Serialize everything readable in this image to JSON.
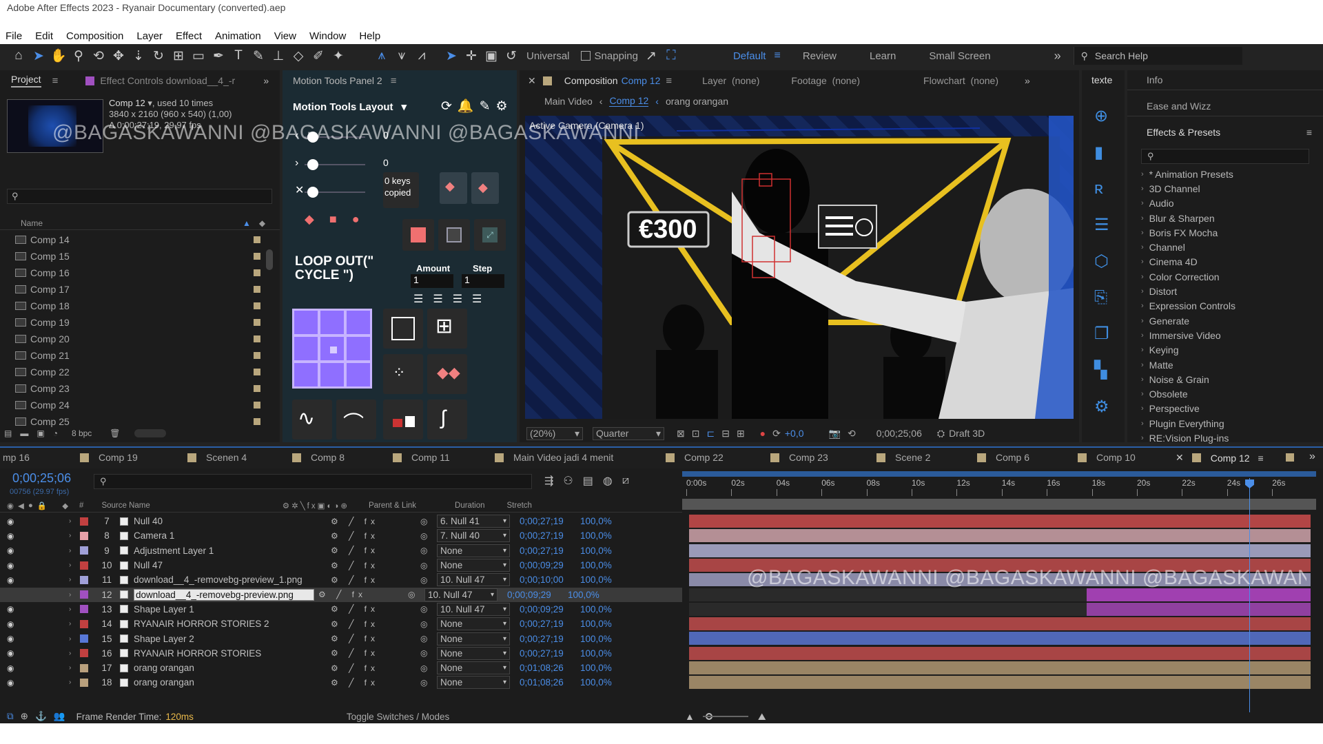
{
  "title": "Adobe After Effects 2023 - Ryanair Documentary (converted).aep",
  "menu": [
    "File",
    "Edit",
    "Composition",
    "Layer",
    "Effect",
    "Animation",
    "View",
    "Window",
    "Help"
  ],
  "toolbar": {
    "universal": "Universal",
    "snapping": "Snapping",
    "workspaces": [
      "Default",
      "Review",
      "Learn",
      "Small Screen"
    ],
    "search_help": "Search Help"
  },
  "project": {
    "tab": "Project",
    "effect_controls": "Effect Controls download__4_-r",
    "comp_name": "Comp 12",
    "used": ", used 10 times",
    "res": "3840 x 2160  (960 x 540) (1,00)",
    "dur": "Δ 0;00;27;19, 29,97 fps",
    "col_name": "Name",
    "items": [
      "Comp 14",
      "Comp 15",
      "Comp 16",
      "Comp 17",
      "Comp 18",
      "Comp 19",
      "Comp 20",
      "Comp 21",
      "Comp 22",
      "Comp 23",
      "Comp 24",
      "Comp 25"
    ],
    "bpc": "8 bpc",
    "label_color": "#b9a77d"
  },
  "motion": {
    "tab": "Motion Tools Panel 2",
    "layout": "Motion Tools Layout",
    "val0": "0",
    "val1": "0",
    "val2": "0",
    "keys": "0 keys",
    "copied": "copied",
    "loop": "LOOP OUT(\" CYCLE \")",
    "amount": "Amount",
    "step": "Step",
    "amount_val": "1",
    "step_val": "1"
  },
  "comp": {
    "tab_prefix": "Composition",
    "tab_name": "Comp 12",
    "layer": "Layer  (none)",
    "footage": "Footage  (none)",
    "flowchart": "Flowchart  (none)",
    "crumbs": [
      "Main Video",
      "Comp 12",
      "orang orangan"
    ],
    "camera": "Active Camera (Camera 1)",
    "price": "€300",
    "zoom": "(20%)",
    "quality": "Quarter",
    "exposure": "+0,0",
    "timecode": "0;00;25;06",
    "renderer": "Draft 3D"
  },
  "texte": "texte",
  "right": {
    "info": "Info",
    "ease": "Ease and Wizz",
    "effects_title": "Effects & Presets",
    "items": [
      "* Animation Presets",
      "3D Channel",
      "Audio",
      "Blur & Sharpen",
      "Boris FX Mocha",
      "Channel",
      "Cinema 4D",
      "Color Correction",
      "Distort",
      "Expression Controls",
      "Generate",
      "Immersive Video",
      "Keying",
      "Matte",
      "Noise & Grain",
      "Obsolete",
      "Perspective",
      "Plugin Everything",
      "RE:Vision Plug-ins"
    ]
  },
  "tabs": [
    "mp 16",
    "Comp 19",
    "Scenen 4",
    "Comp 8",
    "Comp 11",
    "Main Video jadi 4 menit",
    "Comp 22",
    "Comp 23",
    "Scene 2",
    "Comp 6",
    "Comp 10",
    "Comp 12"
  ],
  "timeline": {
    "timecode": "0;00;25;06",
    "frames": "00756 (29.97 fps)",
    "col_source": "Source Name",
    "col_parent": "Parent & Link",
    "col_duration": "Duration",
    "col_stretch": "Stretch",
    "ruler": [
      "0:00s",
      "02s",
      "04s",
      "06s",
      "08s",
      "10s",
      "12s",
      "14s",
      "16s",
      "18s",
      "20s",
      "22s",
      "24s",
      "26s"
    ],
    "layers": [
      {
        "num": "7",
        "name": "Null 40",
        "parent": "6. Null 41",
        "dur": "0;00;27;19",
        "str": "100,0%",
        "color": "#c24040",
        "bar": "#b24545",
        "start": 0,
        "end": 1
      },
      {
        "num": "8",
        "name": "Camera 1",
        "parent": "7. Null 40",
        "dur": "0;00;27;19",
        "str": "100,0%",
        "color": "#e8a0a8",
        "bar": "#b48f95",
        "start": 0,
        "end": 1
      },
      {
        "num": "9",
        "name": "Adjustment Layer 1",
        "parent": "None",
        "dur": "0;00;27;19",
        "str": "100,0%",
        "color": "#a0a0d8",
        "bar": "#9a9ab8",
        "start": 0,
        "end": 1
      },
      {
        "num": "10",
        "name": "Null 47",
        "parent": "None",
        "dur": "0;00;09;29",
        "str": "100,0%",
        "color": "#c24040",
        "bar": "#a84545",
        "start": 0,
        "end": 1
      },
      {
        "num": "11",
        "name": "download__4_-removebg-preview_1.png",
        "parent": "10. Null 47",
        "dur": "0;00;10;00",
        "str": "100,0%",
        "color": "#a0a0d8",
        "bar": "#8a8aa8",
        "start": 0,
        "end": 1
      },
      {
        "num": "12",
        "name": "download__4_-removebg-preview.png",
        "parent": "10. Null 47",
        "dur": "0;00;09;29",
        "str": "100,0%",
        "color": "#a050c0",
        "bar": "#a040b0",
        "start": 0.64,
        "end": 1
      },
      {
        "num": "13",
        "name": "Shape Layer 1",
        "parent": "10. Null 47",
        "dur": "0;00;09;29",
        "str": "100,0%",
        "color": "#a050c0",
        "bar": "#9040a0",
        "start": 0.64,
        "end": 1
      },
      {
        "num": "14",
        "name": "RYANAIR HORROR STORIES 2",
        "parent": "None",
        "dur": "0;00;27;19",
        "str": "100,0%",
        "color": "#c24040",
        "bar": "#a84545",
        "start": 0,
        "end": 1
      },
      {
        "num": "15",
        "name": "Shape Layer 2",
        "parent": "None",
        "dur": "0;00;27;19",
        "str": "100,0%",
        "color": "#5878d8",
        "bar": "#5068b8",
        "start": 0,
        "end": 1
      },
      {
        "num": "16",
        "name": "RYANAIR HORROR STORIES",
        "parent": "None",
        "dur": "0;00;27;19",
        "str": "100,0%",
        "color": "#c24040",
        "bar": "#a84545",
        "start": 0,
        "end": 1
      },
      {
        "num": "17",
        "name": "orang orangan",
        "parent": "None",
        "dur": "0;01;08;26",
        "str": "100,0%",
        "color": "#b9a07d",
        "bar": "#9a8565",
        "start": 0,
        "end": 1
      },
      {
        "num": "18",
        "name": "orang orangan",
        "parent": "None",
        "dur": "0;01;08;26",
        "str": "100,0%",
        "color": "#b9a07d",
        "bar": "#9a8565",
        "start": 0,
        "end": 1
      }
    ],
    "render_label": "Frame Render Time:",
    "render_val": "120ms",
    "toggle": "Toggle Switches / Modes"
  },
  "watermark": "@BAGASKAWANNI @BAGASKAWANNI @BAGASKAWANNI"
}
